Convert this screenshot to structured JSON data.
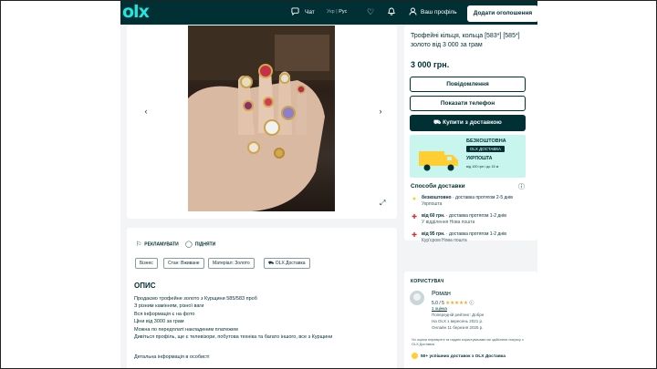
{
  "header": {
    "logo": "olx",
    "chat_label": "Чат",
    "lang_ukr": "Укр",
    "lang_sep": "|",
    "lang_rus": "Рус",
    "profile_label": "Ваш профіль",
    "post_button": "Додати оголошення"
  },
  "listing": {
    "title": "Трофейні кільця, кольца [583*] [585*] золото від 3 000 за грам",
    "price": "3 000 грн.",
    "message_button": "Повідомлення",
    "phone_button": "Показати телефон",
    "buy_button": "Купити з доставкою"
  },
  "banner": {
    "headline": "БЕЗКОШТОВНА",
    "pill": "OLX ДОСТАВКА",
    "carrier": "УКРПОШТА",
    "note": "від 100 грн і до 15 кг"
  },
  "shipping": {
    "heading": "Способи доставки",
    "options": [
      {
        "price": "безкоштовно",
        "text": " · доставка протягом 2-5 днів",
        "carrier": "Укрпошта"
      },
      {
        "price": "від 60 грн.",
        "text": " · доставка протягом 1-2 днів",
        "carrier": "У відділення Нова пошта"
      },
      {
        "price": "від 95 грн.",
        "text": " · доставка протягом 1-2 днів",
        "carrier": "Кур'єром Нова пошта"
      }
    ]
  },
  "seller": {
    "heading": "КОРИСТУВАЧ",
    "name": "Роман",
    "rating": "5.0 / 5",
    "stars": "★★★★★",
    "rating_count": "1 оцінка",
    "recent_rating": "Попередній рейтинг: Добре",
    "on_olx": "На OLX з вересень 2021 р.",
    "online": "Онлайн 11 березня 2025 р.",
    "note": "Усі оцінки перевірені та надані користувачами які здійснили покупку з OLX Доставка",
    "badge": "50+ успішних доставок з OLX Доставка"
  },
  "details": {
    "promote": "РЕКЛАМУВАТИ",
    "raise": "ПІДНЯТИ",
    "tags": [
      "Бізнес",
      "Стан: Вживане",
      "Матеріал: Золото",
      "OLX Доставка"
    ],
    "heading": "ОПИС",
    "description_lines": [
      "Продаємо трофейне золото з Курщини 585/583 проб",
      "З різним камінням, різної ваги",
      "Вся інформація є на фото",
      "Ціни від 3000 за грам",
      "Можна по передплаті накладеним платежем",
      "Дивіться профіль, ще є телевізори, побутова техніка та багато іншого, все з Курщини"
    ],
    "more_info": "Детальна інформація в особисті"
  },
  "colors": {
    "brand_dark": "#002f34",
    "brand_accent": "#23e5db",
    "banner_bg": "#c8f5ee",
    "star": "#f6a623"
  }
}
